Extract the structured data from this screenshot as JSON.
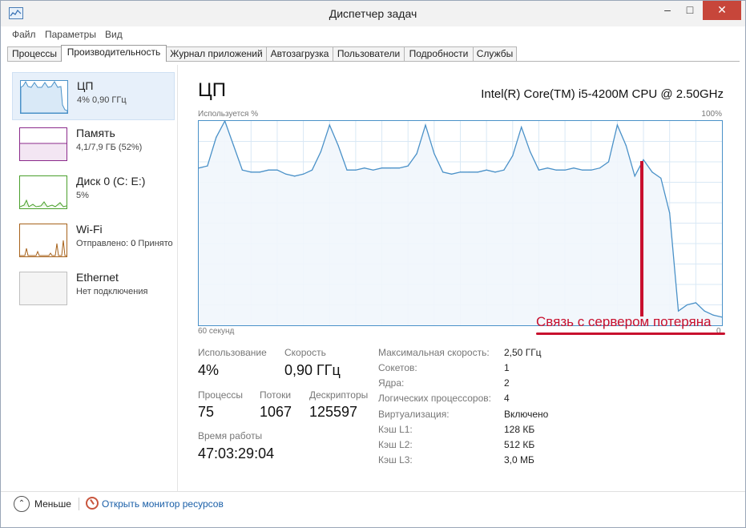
{
  "window": {
    "title": "Диспетчер задач"
  },
  "menu": [
    "Файл",
    "Параметры",
    "Вид"
  ],
  "tabs": [
    "Процессы",
    "Производительность",
    "Журнал приложений",
    "Автозагрузка",
    "Пользователи",
    "Подробности",
    "Службы"
  ],
  "active_tab": "Производительность",
  "sidebar": [
    {
      "name": "ЦП",
      "sub": "4% 0,90 ГГц",
      "icon": "cpu-graph-icon",
      "color": "#4a91c8"
    },
    {
      "name": "Память",
      "sub": "4,1/7,9 ГБ (52%)",
      "icon": "memory-graph-icon",
      "color": "#8b2a8b"
    },
    {
      "name": "Диск 0 (C: E:)",
      "sub": "5%",
      "icon": "disk-graph-icon",
      "color": "#4aa02c"
    },
    {
      "name": "Wi-Fi",
      "sub_label": "Отправлено:",
      "sub_value": "0",
      "sub_more": "Принято",
      "icon": "wifi-graph-icon",
      "color": "#a7621b"
    },
    {
      "name": "Ethernet",
      "sub": "Нет подключения",
      "icon": "ethernet-graph-icon",
      "color": "#bfbfbf"
    }
  ],
  "main": {
    "title": "ЦП",
    "cpu_model": "Intel(R) Core(TM) i5-4200M CPU @ 2.50GHz",
    "y_label": "Используется %",
    "y_max_label": "100%",
    "x_label": "60 секунд",
    "y_min_label": "0",
    "stats": {
      "usage_label": "Использование",
      "usage_value": "4%",
      "speed_label": "Скорость",
      "speed_value": "0,90 ГГц",
      "processes_label": "Процессы",
      "processes_value": "75",
      "threads_label": "Потоки",
      "threads_value": "1067",
      "handles_label": "Дескрипторы",
      "handles_value": "125597",
      "uptime_label": "Время работы",
      "uptime_value": "47:03:29:04"
    },
    "details": [
      {
        "key": "Максимальная скорость:",
        "value": "2,50 ГГц"
      },
      {
        "key": "Сокетов:",
        "value": "1"
      },
      {
        "key": "Ядра:",
        "value": "2"
      },
      {
        "key": "Логических процессоров:",
        "value": "4"
      },
      {
        "key": "Виртуализация:",
        "value": "Включено"
      },
      {
        "key": "Кэш L1:",
        "value": "128 КБ"
      },
      {
        "key": "Кэш L2:",
        "value": "512 КБ"
      },
      {
        "key": "Кэш L3:",
        "value": "3,0 МБ"
      }
    ]
  },
  "annotation": {
    "text": "Связь с сервером потеряна",
    "color": "#c8102e"
  },
  "footer": {
    "fewer_label": "Меньше",
    "monitor_link": "Открыть монитор ресурсов"
  },
  "colors": {
    "accent": "#4a91c8",
    "chart_fill": "#f1f6fc"
  },
  "chart_data": {
    "type": "area",
    "title": "",
    "xlabel": "60 секунд",
    "ylabel": "Используется %",
    "xlim": [
      0,
      60
    ],
    "ylim": [
      0,
      100
    ],
    "x": [
      0,
      1,
      2,
      3,
      4,
      5,
      6,
      7,
      8,
      9,
      10,
      11,
      12,
      13,
      14,
      15,
      16,
      17,
      18,
      19,
      20,
      21,
      22,
      23,
      24,
      25,
      26,
      27,
      28,
      29,
      30,
      31,
      32,
      33,
      34,
      35,
      36,
      37,
      38,
      39,
      40,
      41,
      42,
      43,
      44,
      45,
      46,
      47,
      48,
      49,
      50,
      51,
      52,
      53,
      54,
      55,
      56,
      57,
      58,
      59,
      60
    ],
    "values": [
      77,
      78,
      92,
      100,
      88,
      76,
      75,
      75,
      76,
      76,
      74,
      73,
      74,
      76,
      85,
      98,
      88,
      76,
      76,
      77,
      76,
      77,
      77,
      77,
      78,
      84,
      98,
      84,
      75,
      74,
      75,
      75,
      75,
      76,
      75,
      76,
      83,
      97,
      85,
      76,
      77,
      76,
      76,
      77,
      76,
      76,
      77,
      80,
      98,
      88,
      73,
      81,
      75,
      72,
      55,
      7,
      10,
      11,
      7,
      5,
      4
    ],
    "grid": true,
    "legend": "none"
  }
}
